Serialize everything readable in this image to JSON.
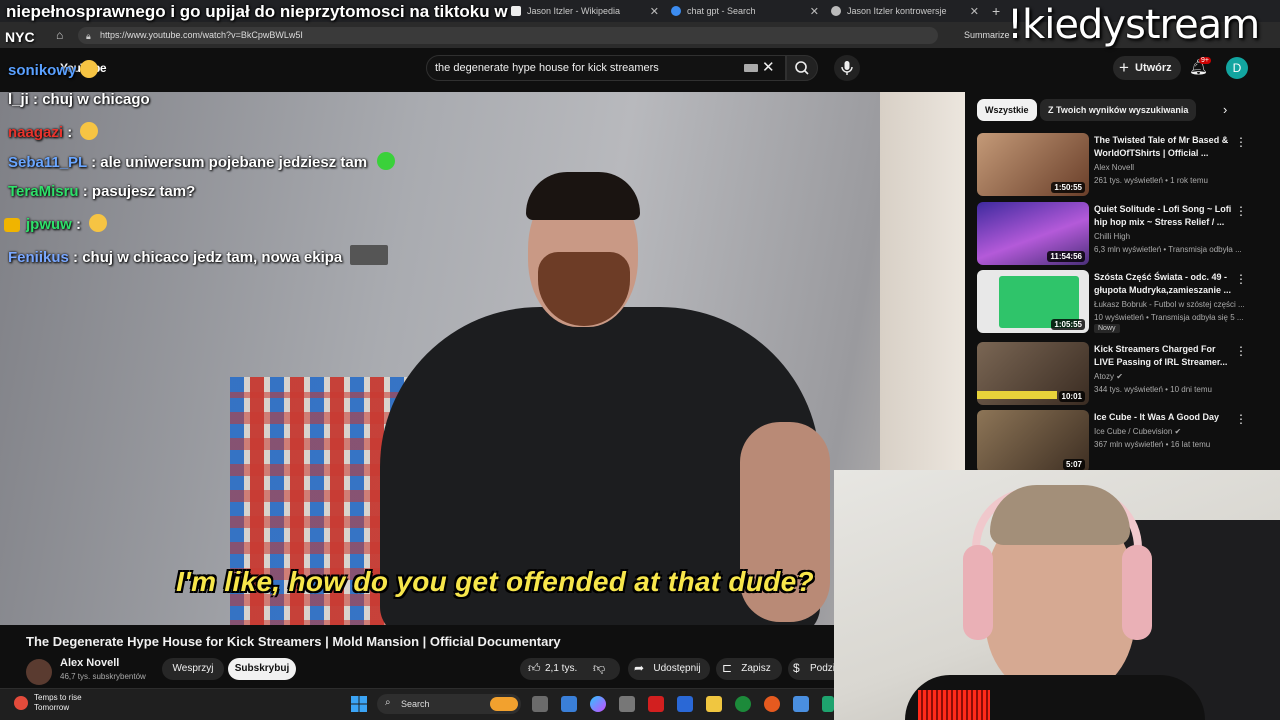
{
  "browser": {
    "tabs": [
      {
        "label": "",
        "x_label": "✕"
      },
      {
        "label": "",
        "x_label": ""
      },
      {
        "label": "Jason Itzler - Wikipedia",
        "x_label": "✕"
      },
      {
        "label": "chat gpt - Search",
        "x_label": "✕"
      },
      {
        "label": "Jason Itzler kontrowersje",
        "x_label": "✕"
      }
    ],
    "url": "https://www.youtube.com/watch?v=BkCpwBWLw5I",
    "summarize_label": "Summarize"
  },
  "overlay": {
    "top_caption": "niepełnosprawnego i go upijał do nieprzytomosci na tiktoku w",
    "city": "NYC",
    "streamer_tag": "!kiedystream"
  },
  "chat": {
    "messages": [
      {
        "user": "sonikowy",
        "text": "",
        "user_color": "#5aa0ff"
      },
      {
        "user": "l_ji",
        "text": " : chuj w chicago",
        "user_color": "#ffffff"
      },
      {
        "user": "naagazi",
        "text": " :",
        "user_color": "#e8332c"
      },
      {
        "user": "Seba11_PL",
        "text": " : ale uniwersum pojebane jedziesz tam",
        "user_color": "#6aa6ff"
      },
      {
        "user": "TeraMisru",
        "text": " : pasujesz tam?",
        "user_color": "#2fe06a"
      },
      {
        "user": "jpwuw",
        "text": " :",
        "user_color": "#2fe06a"
      },
      {
        "user": "Feniikus",
        "text": " : chuj w chicaco jedz tam, nowa ekipa",
        "user_color": "#7aa8ff"
      }
    ]
  },
  "youtube": {
    "logo_text": "YouTube",
    "search_query": "the degenerate hype house for kick streamers",
    "create_label": "Utwórz",
    "notif_count": "9+",
    "avatar_letter": "D",
    "video": {
      "subtitle": "I'm like, how do you get offended at that dude?",
      "title": "The Degenerate Hype House for Kick Streamers | Mold Mansion | Official Documentary",
      "channel": "Alex Novell",
      "subs": "46,7 tys. subskrybentów",
      "support_label": "Wesprzyj",
      "subscribe_label": "Subskrybuj",
      "likes": "2,1 tys.",
      "share_label": "Udostępnij",
      "save_label": "Zapisz",
      "more_label": "Podzi"
    },
    "chips": [
      "Wszystkie",
      "Z Twoich wyników wyszukiwania"
    ],
    "recommendations": [
      {
        "title": "The Twisted Tale of Mr Based & WorldOfTShirts | Official ...",
        "channel": "Alex Novell",
        "meta": "261 tys. wyświetleń • 1 rok temu",
        "duration": "1:50:55",
        "thumb": "#8a5a3a"
      },
      {
        "title": "Quiet Solitude - Lofi Song ~ Lofi hip hop mix ~ Stress Relief / ...",
        "channel": "Chilli High",
        "meta": "6,3 mln wyświetleń • Transmisja odbyła ...",
        "duration": "11:54:56",
        "thumb": "#7a3fc2"
      },
      {
        "title": "Szósta Część Świata - odc. 49 - głupota Mudryka,zamieszanie ...",
        "channel": "Łukasz Bobruk - Futbol w szóstej części ...",
        "meta": "10 wyświetleń • Transmisja odbyła się 5 ...",
        "duration": "1:05:55",
        "thumb": "#2fc46a",
        "badge": "Nowy"
      },
      {
        "title": "Kick Streamers Charged For LIVE Passing of IRL Streamer...",
        "channel": "Atozy",
        "meta": "344 tys. wyświetleń • 10 dni temu",
        "duration": "10:01",
        "thumb": "#5c4a3c"
      },
      {
        "title": "Ice Cube - It Was A Good Day",
        "channel": "Ice Cube / Cubevision",
        "meta": "367 mln wyświetleń • 16 lat temu",
        "duration": "5:07",
        "thumb": "#6e5a44"
      }
    ]
  },
  "taskbar": {
    "weather_title": "Temps to rise",
    "weather_sub": "Tomorrow",
    "search_label": "Search"
  }
}
